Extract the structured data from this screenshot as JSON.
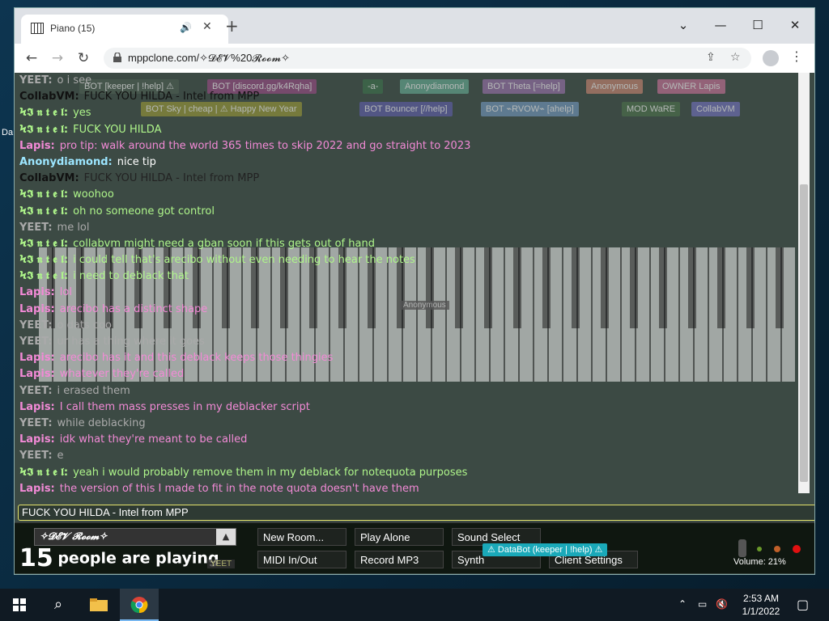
{
  "desktop": {
    "label": "Da"
  },
  "browser": {
    "tab_title": "Piano (15)",
    "tab_audio_icon": "speaker-icon",
    "url": "mppclone.com/✧𝓓𝓔𝓥%20𝓡𝓸𝓸𝓶✧",
    "window_buttons": [
      "⌄",
      "—",
      "☐",
      "✕"
    ]
  },
  "badges": [
    {
      "text": "BOT [keeper | !help] ⚠",
      "color": "#4a5a4f"
    },
    {
      "text": "BOT [discord.gg/k4Rqha]",
      "color": "#8a4a7a"
    },
    {
      "text": "-a-",
      "color": "#3d6a4a"
    },
    {
      "text": "Anonydiamond",
      "color": "#5f9a86"
    },
    {
      "text": "BOT Theta [=help]",
      "color": "#8a6a9a"
    },
    {
      "text": "Anonymous",
      "color": "#b07a6a"
    },
    {
      "text": "OWNER Lapis",
      "color": "#b06a8a"
    },
    {
      "text": "BOT Sky | cheap | ⚠ Happy New Year",
      "color": "#8a8a3a"
    },
    {
      "text": "BOT Bouncer [//help]",
      "color": "#5a5a9a"
    },
    {
      "text": "BOT ⌁RVOW⌁ [ahelp]",
      "color": "#6a8aaa"
    },
    {
      "text": "MOD WaRE",
      "color": "#4a6a4a"
    },
    {
      "text": "CollabVM",
      "color": "#6a6aaa"
    }
  ],
  "messages": [
    {
      "name": "YEET:",
      "text": "o i see",
      "nc": "#aaaaaa",
      "tc": "#aaaaaa"
    },
    {
      "name": "CollabVM:",
      "text": "FUCK YOU HILDA - Intel from MPP",
      "nc": "#111111",
      "tc": "#111111"
    },
    {
      "name": "Ϟ𝕴 𝖓 𝖙 𝖊 𝖑:",
      "text": "yes",
      "nc": "#aef58a",
      "tc": "#aef58a"
    },
    {
      "name": "Ϟ𝕴 𝖓 𝖙 𝖊 𝖑:",
      "text": "FUCK YOU HILDA",
      "nc": "#aef58a",
      "tc": "#aef58a"
    },
    {
      "name": "Lapis:",
      "text": "pro tip: walk around the world 365 times to skip 2022 and go straight to 2023",
      "nc": "#f28ad6",
      "tc": "#f28ad6"
    },
    {
      "name": "Anonydiamond:",
      "text": "nice tip",
      "nc": "#9ce6ff",
      "tc": "#ffffff"
    },
    {
      "name": "CollabVM:",
      "text": "FUCK YOU HILDA - Intel from MPP",
      "nc": "#111111",
      "tc": "#222222"
    },
    {
      "name": "Ϟ𝕴 𝖓 𝖙 𝖊 𝖑:",
      "text": "woohoo",
      "nc": "#aef58a",
      "tc": "#aef58a"
    },
    {
      "name": "Ϟ𝕴 𝖓 𝖙 𝖊 𝖑:",
      "text": "oh no someone got control",
      "nc": "#aef58a",
      "tc": "#aef58a"
    },
    {
      "name": "YEET:",
      "text": "me lol",
      "nc": "#aaaaaa",
      "tc": "#aaaaaa"
    },
    {
      "name": "Ϟ𝕴 𝖓 𝖙 𝖊 𝖑:",
      "text": "collabvm might need a gban soon if this gets out of hand",
      "nc": "#aef58a",
      "tc": "#aef58a"
    },
    {
      "name": "Ϟ𝕴 𝖓 𝖙 𝖊 𝖑:",
      "text": "i could tell that's arecibo without even needing to hear the notes",
      "nc": "#aef58a",
      "tc": "#aef58a"
    },
    {
      "name": "Ϟ𝕴 𝖓 𝖙 𝖊 𝖑:",
      "text": "i need to deblack that",
      "nc": "#aef58a",
      "tc": "#aef58a"
    },
    {
      "name": "Lapis:",
      "text": "lol",
      "nc": "#f28ad6",
      "tc": "#f28ad6"
    },
    {
      "name": "Lapis:",
      "text": "arecibo has a distinct shape",
      "nc": "#f28ad6",
      "tc": "#f28ad6"
    },
    {
      "name": "YEET:",
      "text": "o dats coo",
      "nc": "#aaaaaa",
      "tc": "#aaaaaa"
    },
    {
      "name": "YEET:",
      "text": "ur has a thing where it goes",
      "nc": "#aaaaaa",
      "tc": "#aaaaaa"
    },
    {
      "name": "Lapis:",
      "text": "arecibo has it and this deblack keeps those thingies",
      "nc": "#f28ad6",
      "tc": "#f28ad6"
    },
    {
      "name": "Lapis:",
      "text": "whatever they're called",
      "nc": "#f28ad6",
      "tc": "#f28ad6"
    },
    {
      "name": "YEET:",
      "text": "i erased them",
      "nc": "#aaaaaa",
      "tc": "#aaaaaa"
    },
    {
      "name": "Lapis:",
      "text": "I call them mass presses in my deblacker script",
      "nc": "#f28ad6",
      "tc": "#f28ad6"
    },
    {
      "name": "YEET:",
      "text": "while deblacking",
      "nc": "#aaaaaa",
      "tc": "#aaaaaa"
    },
    {
      "name": "Lapis:",
      "text": "idk what they're meant to be called",
      "nc": "#f28ad6",
      "tc": "#f28ad6"
    },
    {
      "name": "YEET:",
      "text": "e",
      "nc": "#aaaaaa",
      "tc": "#aaaaaa"
    },
    {
      "name": "Ϟ𝕴 𝖓 𝖙 𝖊 𝖑:",
      "text": "yeah i would probably remove them in my deblack for notequota purposes",
      "nc": "#aef58a",
      "tc": "#aef58a"
    },
    {
      "name": "Lapis:",
      "text": "the version of this I made to fit in the note quota doesn't have them",
      "nc": "#f28ad6",
      "tc": "#f28ad6"
    }
  ],
  "chat_input": {
    "value": "FUCK YOU HILDA - Intel from MPP"
  },
  "room": {
    "name": "✧𝓓𝓔𝓥 𝓡𝓸𝓸𝓶✧",
    "people_count": "15",
    "people_label": "people are playing"
  },
  "buttons": {
    "new_room": "New Room...",
    "play_alone": "Play Alone",
    "sound_select": "Sound Select",
    "midi": "MIDI In/Out",
    "record": "Record MP3",
    "synth": "Synth",
    "client_settings": "Client Settings"
  },
  "volume": "Volume: 21%",
  "overlays": {
    "databot": "⚠ DataBot (keeper | !help) ⚠",
    "yeet_cursor": "YEET",
    "anonymous_cursor": "Anonymous"
  },
  "taskbar": {
    "time": "2:53 AM",
    "date": "1/1/2022"
  }
}
